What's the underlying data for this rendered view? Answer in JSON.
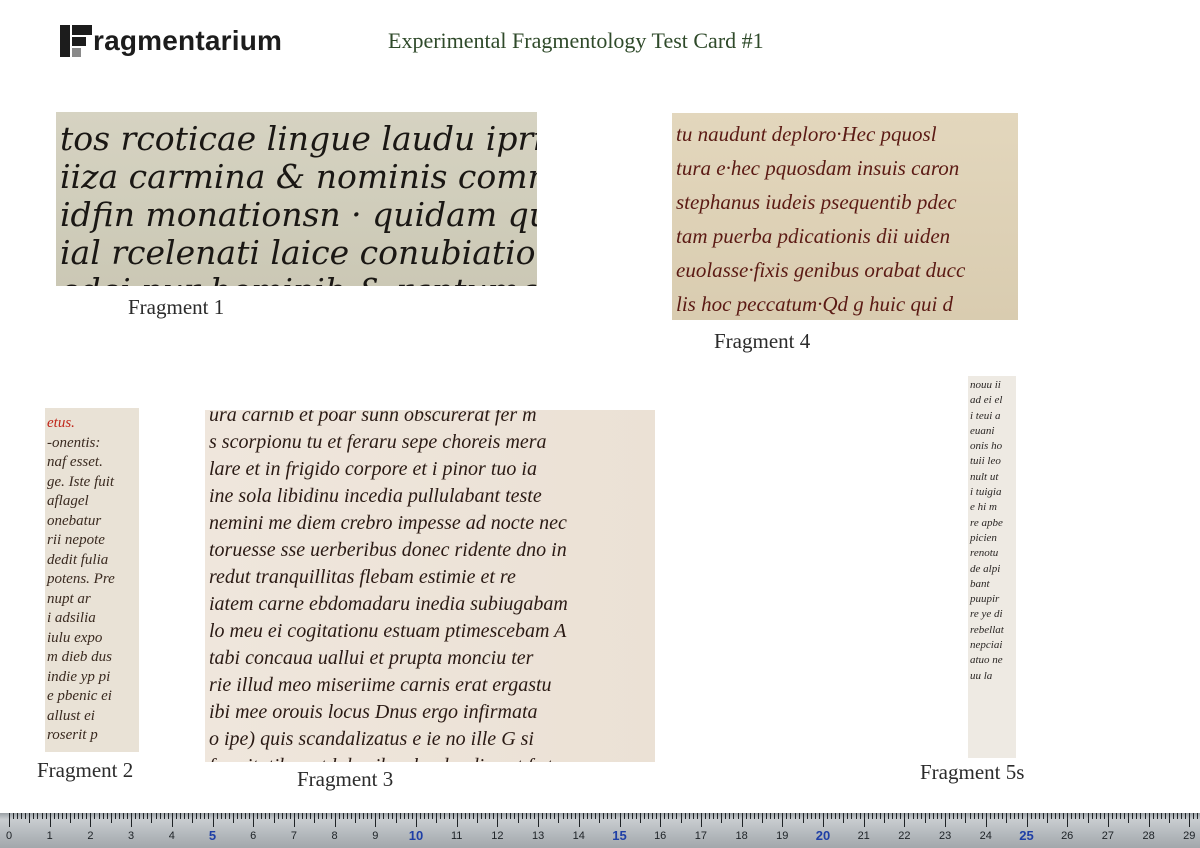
{
  "logo": {
    "text": "ragmentarium"
  },
  "title": "Experimental Fragmentology Test Card #1",
  "fragments": {
    "f1": {
      "caption": "Fragment 1",
      "lines": [
        "tos  rcoticae lingue laudu iprius",
        "iiza carmina & nominis comme",
        "idfin monationsn · quidam quamlib",
        "ial  rcelenati laice conubiatio",
        "edei  nur hominih & rantuma ntu"
      ]
    },
    "f4": {
      "caption": "Fragment 4",
      "lines": [
        "tu naudunt deploro·Hec pquosl",
        "tura e·hec pquosdam insuis caron",
        "stephanus iudeis psequentib pdec",
        "tam puerba pdicationis dii uiden",
        "euolasse·fixis genibus orabat ducc",
        "lis hoc peccatum·Qd g huic qui d"
      ]
    },
    "f2": {
      "caption": "Fragment 2",
      "lines": [
        "etus.",
        "-onentis:",
        "naf esset.",
        "ge. Iste fuit",
        "aflagel",
        "onebatur",
        "rii nepote",
        "dedit fulia",
        "potens. Pre",
        "nupt ar",
        "i adsilia",
        "iulu expo",
        "m dieb dus",
        "indie yp pi",
        "e pbenic ei",
        "allust ei",
        "roserit p"
      ]
    },
    "f3": {
      "caption": "Fragment 3",
      "lines": [
        "ura carnib et poar sunn obscurerat fer m",
        "s scorpionu tu et feraru sepe choreis mera",
        "lare et in frigido corpore et i pinor tuo ia",
        "ine sola libidinu incedia pullulabant teste",
        "nemini me diem crebro impesse ad nocte nec",
        "toruesse sse uerberibus donec ridente dno in",
        "redut tranquillitas flebam estimie et re",
        "iatem carne ebdomadaru inedia subiugabam",
        "lo meu ei cogitationu estuam ptimescebam A",
        "tabi concaua uallui et prupta monciu ter",
        "rie illud meo miseriime carnis erat ergastu",
        "ibi mee orouis locus Dnus ergo infirmata",
        "o ipe) quis scandalizatus e ie no ille G si",
        "furmitatibus et laboribus laudundi sunt fe te"
      ]
    },
    "f5": {
      "caption": "Fragment 5s",
      "lines": [
        "nouu ii",
        "ad ei el",
        "i teui a",
        "euani",
        "onis ho",
        "tuii leo",
        "nult ut",
        "i tuigia",
        "e hi m",
        "re apbe",
        "picien",
        "renotu",
        "de alpi",
        "bant",
        "puupir",
        "re ye di",
        "rebellat",
        "nepciai",
        "atuo ne",
        "uu la"
      ]
    }
  },
  "ruler": {
    "labels": [
      "0",
      "1",
      "2",
      "3",
      "4",
      "5",
      "6",
      "7",
      "8",
      "9",
      "10",
      "11",
      "12",
      "13",
      "14",
      "15",
      "16",
      "17",
      "18",
      "19",
      "20",
      "21",
      "22",
      "23",
      "24",
      "25",
      "26",
      "27",
      "28",
      "29"
    ],
    "highlight_labels": [
      "5",
      "10",
      "15",
      "20",
      "25"
    ],
    "highlight_color": "#1f3fa6"
  }
}
